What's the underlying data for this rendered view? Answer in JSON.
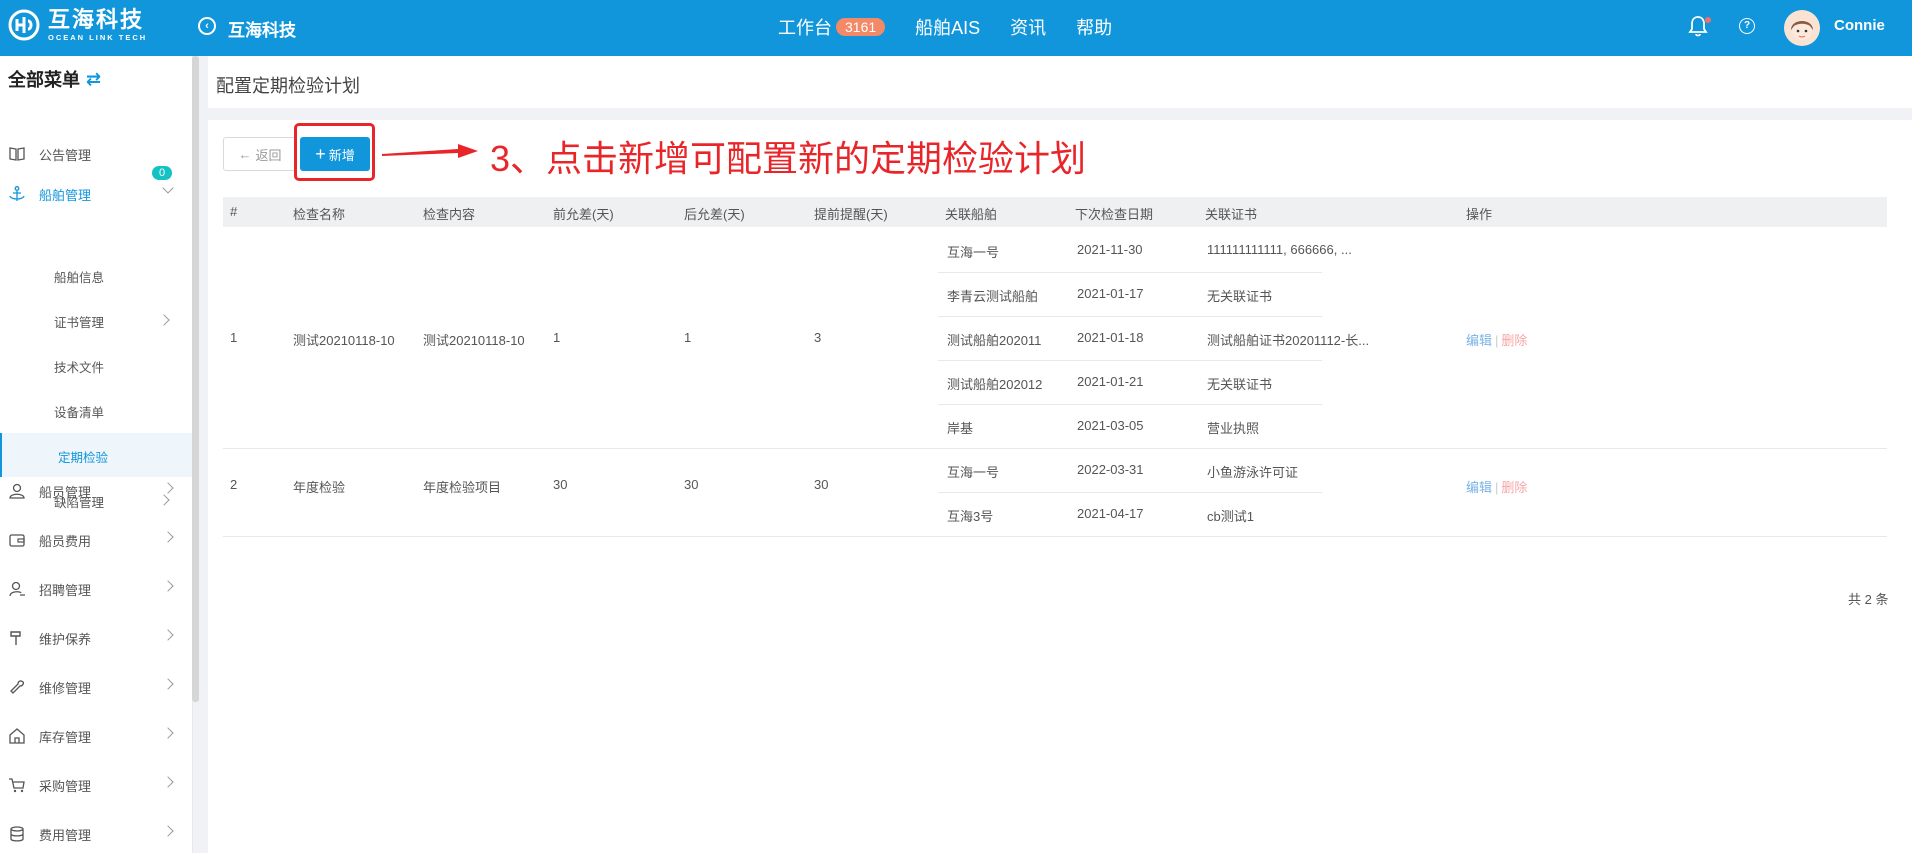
{
  "topbar": {
    "logo_cn": "互海科技",
    "logo_en": "OCEAN LINK TECH",
    "brand": "互海科技",
    "nav": [
      {
        "label": "工作台",
        "badge": "3161"
      },
      {
        "label": "船舶AIS"
      },
      {
        "label": "资讯"
      },
      {
        "label": "帮助"
      }
    ],
    "user": "Connie"
  },
  "sidebar": {
    "all_menu": "全部菜单",
    "notice_count": "0",
    "items": [
      {
        "label": "公告管理",
        "icon": "book-icon"
      },
      {
        "label": "船舶管理",
        "icon": "anchor-icon"
      },
      {
        "label": "船舶信息"
      },
      {
        "label": "证书管理"
      },
      {
        "label": "技术文件"
      },
      {
        "label": "设备清单"
      },
      {
        "label": "定期检验"
      },
      {
        "label": "缺陷管理"
      },
      {
        "label": "船员管理",
        "icon": "user-icon"
      },
      {
        "label": "船员费用",
        "icon": "wallet-icon"
      },
      {
        "label": "招聘管理",
        "icon": "recruit-icon"
      },
      {
        "label": "维护保养",
        "icon": "hammer-icon"
      },
      {
        "label": "维修管理",
        "icon": "wrench-icon"
      },
      {
        "label": "库存管理",
        "icon": "home-icon"
      },
      {
        "label": "采购管理",
        "icon": "cart-icon"
      },
      {
        "label": "费用管理",
        "icon": "database-icon"
      }
    ]
  },
  "page": {
    "title": "配置定期检验计划",
    "back_label": "返回",
    "add_label": "新增",
    "annotation": "3、点击新增可配置新的定期检验计划",
    "total": "共 2 条"
  },
  "table": {
    "headers": [
      "#",
      "检查名称",
      "检查内容",
      "前允差(天)",
      "后允差(天)",
      "提前提醒(天)",
      "关联船舶",
      "下次检查日期",
      "关联证书",
      "操作"
    ],
    "rows": [
      {
        "index": "1",
        "name": "测试20210118-10",
        "content": "测试20210118-10",
        "before": "1",
        "after": "1",
        "remind": "3",
        "ships": [
          {
            "ship": "互海一号",
            "date": "2021-11-30",
            "cert": "111111111111, 666666, ..."
          },
          {
            "ship": "李青云测试船舶",
            "date": "2021-01-17",
            "cert": "无关联证书"
          },
          {
            "ship": "测试船舶202011",
            "date": "2021-01-18",
            "cert": "测试船舶证书20201112-长..."
          },
          {
            "ship": "测试船舶202012",
            "date": "2021-01-21",
            "cert": "无关联证书"
          },
          {
            "ship": "岸基",
            "date": "2021-03-05",
            "cert": "营业执照"
          }
        ],
        "edit": "编辑",
        "delete": "删除"
      },
      {
        "index": "2",
        "name": "年度检验",
        "content": "年度检验项目",
        "before": "30",
        "after": "30",
        "remind": "30",
        "ships": [
          {
            "ship": "互海一号",
            "date": "2022-03-31",
            "cert": "小鱼游泳许可证"
          },
          {
            "ship": "互海3号",
            "date": "2021-04-17",
            "cert": "cb测试1"
          }
        ],
        "edit": "编辑",
        "delete": "删除"
      }
    ]
  },
  "colors": {
    "primary": "#1296db",
    "annotation": "#e8262a"
  }
}
